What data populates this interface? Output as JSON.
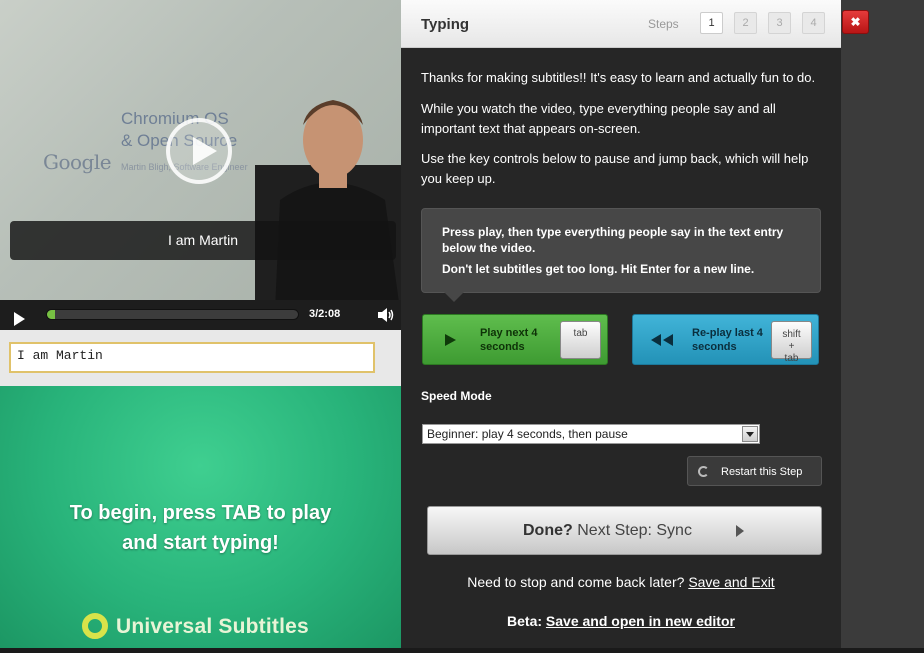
{
  "video": {
    "slide_logo": "Google",
    "slide_title": "Chromium OS\n& Open Source",
    "slide_subtitle": "Martin Bligh, Software Engineer",
    "caption": "I am Martin",
    "time": "3/2:08",
    "progress": 0.03,
    "icons": {
      "play": "play-icon",
      "volume": "volume-icon",
      "overlay": "play-overlay-icon"
    }
  },
  "entry": {
    "value": "I am Martin"
  },
  "splash": {
    "line1": "To begin, press TAB to play",
    "line2": "and start typing!",
    "brand": "Universal Subtitles",
    "brand_color": "#d8e34a"
  },
  "panel": {
    "title": "Typing",
    "steps_label": "Steps",
    "steps": [
      "1",
      "2",
      "3",
      "4"
    ],
    "active_step": "1",
    "intro": [
      "Thanks for making subtitles!! It's easy to learn and actually fun to do.",
      "While you watch the video, type everything people say and all important text that appears on-screen.",
      "Use the key controls below to pause and jump back, which will help you keep up."
    ],
    "tip": [
      "Press play, then type everything people say in the text entry below the video.",
      "Don't let subtitles get too long. Hit Enter for a new line."
    ],
    "play_button": {
      "label": "Play next 4 seconds",
      "key": "tab",
      "color": "#4fae3f"
    },
    "replay_button": {
      "label": "Re-play last 4 seconds",
      "key_line1": "shift",
      "key_line2": "+",
      "key_line3": "tab",
      "color": "#31a4c8"
    },
    "speed_label": "Speed Mode",
    "speed_value": "Beginner: play 4 seconds, then pause",
    "restart_label": "Restart this Step",
    "done_bold": "Done?",
    "done_rest": "Next Step: Sync",
    "stop_text": "Need to stop and come back later?",
    "save_exit": "Save and Exit",
    "beta_label": "Beta:",
    "beta_link": "Save and open in new editor"
  },
  "close_label": "✖",
  "close_color": "#d42525"
}
